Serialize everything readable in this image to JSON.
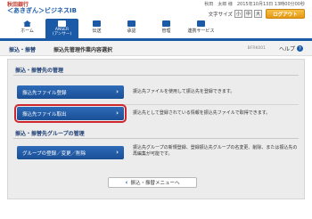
{
  "bank": {
    "name": "秋田銀行",
    "service": "＜あきぎん＞ビジネスIB"
  },
  "user": {
    "line1": "秋田　太郎 様",
    "line2": "2015年10月13日 13時00分00秒"
  },
  "font_size": {
    "label": "文字サイズ",
    "small": "小",
    "medium": "中",
    "large": "大"
  },
  "logout_label": "ログアウト",
  "nav": [
    {
      "label": "ホーム",
      "sub": "",
      "icon": "home-icon"
    },
    {
      "label": "ANSER",
      "sub": "(アンサー)",
      "icon": "anser-icon"
    },
    {
      "label": "伝送",
      "sub": "",
      "icon": "transfer-icon"
    },
    {
      "label": "承認",
      "sub": "",
      "icon": "approve-icon"
    },
    {
      "label": "管理",
      "sub": "",
      "icon": "manage-icon"
    },
    {
      "label": "連携サービス",
      "sub": "",
      "icon": "link-icon"
    }
  ],
  "active_nav_index": 1,
  "breadcrumb": "振込・振替",
  "page_title": "振込先管理作業内容選択",
  "screen_id": "BFRK001",
  "help_label": "ヘルプ",
  "section1": {
    "title": "振込・振替先の管理",
    "buttons": [
      {
        "label": "振込先ファイル登録",
        "desc": "振込先ファイルを使用して振込先を登録できます。"
      },
      {
        "label": "振込先ファイル取出",
        "desc": "振込先として登録されている情報を振込先ファイルで取得できます。"
      }
    ]
  },
  "section2": {
    "title": "振込・振替先グループの管理",
    "buttons": [
      {
        "label": "グループの登録／変更／削除",
        "desc": "振込先グループの新規登録、登録振込先グループの名変更、削除、または振込先の再編集が可能です。"
      }
    ]
  },
  "back_label": "振込・振替メニューへ",
  "colors": {
    "primary": "#1a5aa6",
    "highlight": "#d0272e",
    "logout": "#e59a12"
  }
}
